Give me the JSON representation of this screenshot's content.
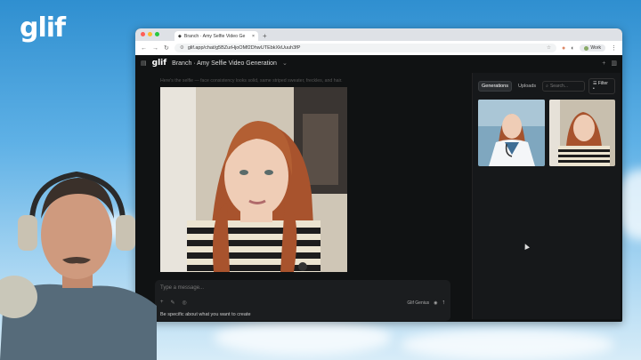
{
  "brand": {
    "logo_text": "glif"
  },
  "browser": {
    "tab_title": "Branch · Amy Selfie Video Ge",
    "new_tab": "+",
    "url": "glif.app/chat/g5BZurHjoOMf2DhwUTEbkXkUuuh3fP",
    "profile_label": "Work"
  },
  "app": {
    "logo_text": "glif",
    "page_title": "Branch · Amy Selfie Video Generation",
    "caption": "Here's the selfie — face consistency looks solid, same striped sweater, freckles, and hair.",
    "composer": {
      "placeholder": "Type a message...",
      "model_label": "Glif Genius",
      "hint": "Be specific about what you want to create"
    },
    "panel": {
      "tabs": [
        "Generations",
        "Uploads"
      ],
      "search_placeholder": "Search...",
      "filter_label": "Filter"
    }
  },
  "colors": {
    "accent": "#3aa0ff",
    "app_bg": "#101213"
  }
}
